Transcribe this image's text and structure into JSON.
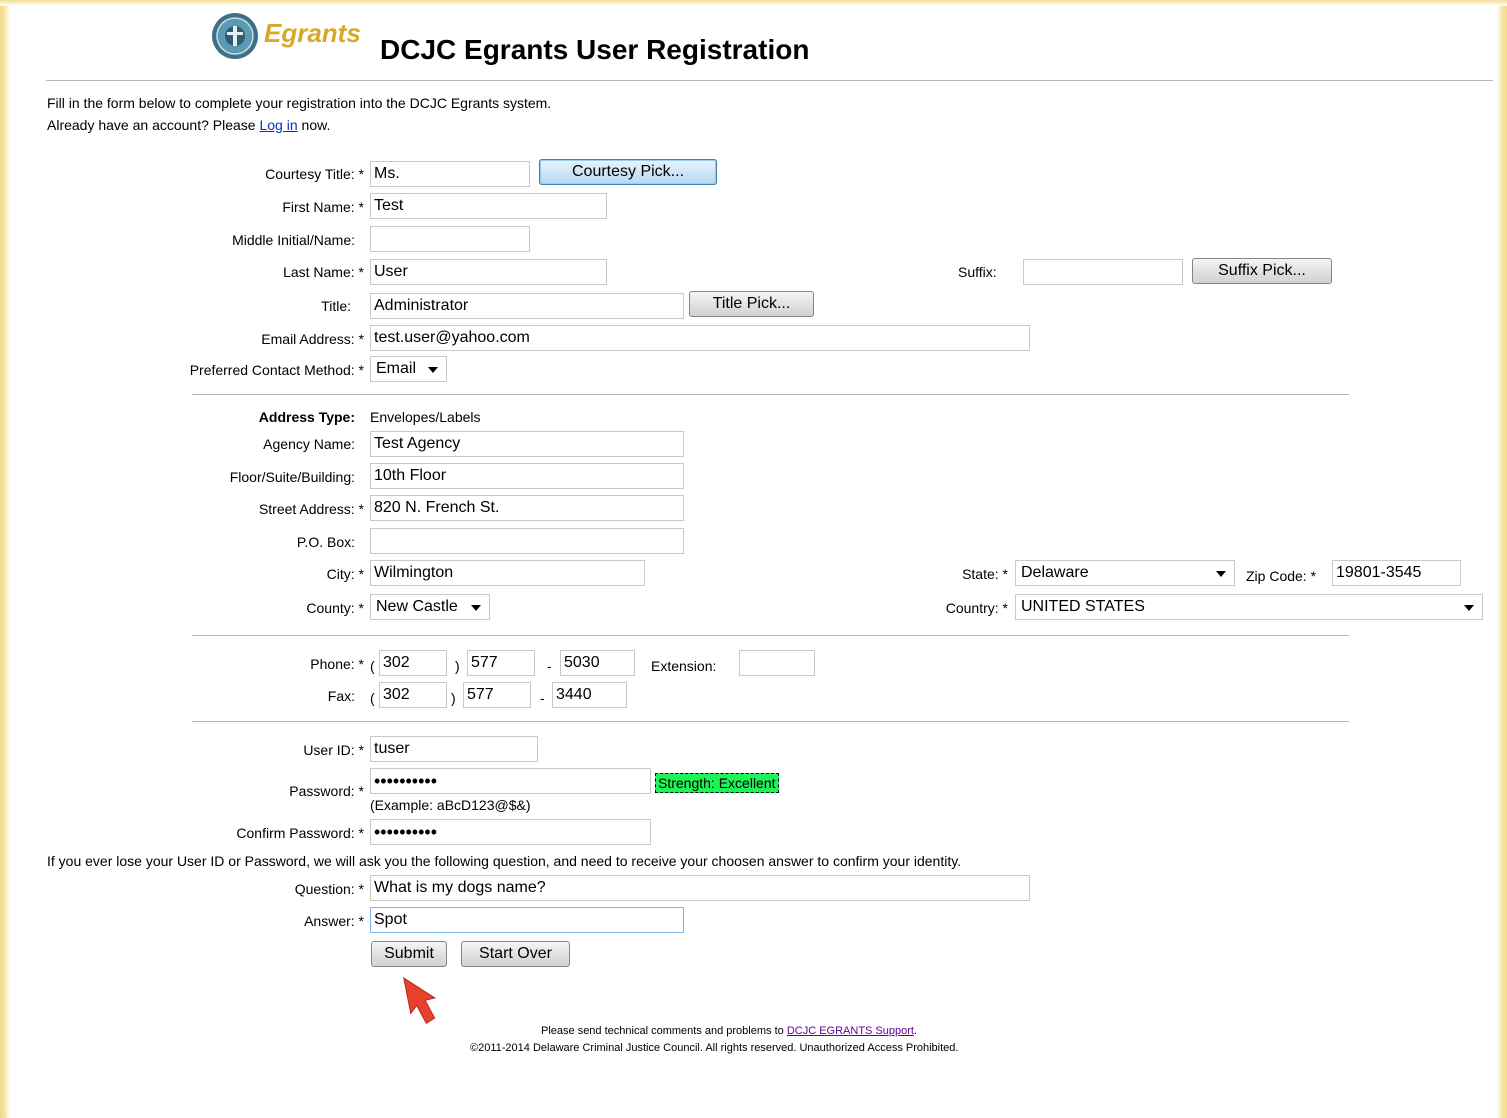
{
  "header": {
    "logo_text": "Egrants",
    "page_title": "DCJC Egrants User Registration"
  },
  "intro": {
    "line1": "Fill in the form below to complete your registration into the DCJC Egrants system.",
    "line2_before": "Already have an account? Please ",
    "login_link": "Log in",
    "line2_after": " now."
  },
  "fields": {
    "courtesy_title": {
      "label": "Courtesy Title: *",
      "value": "Ms.",
      "button": "Courtesy Pick..."
    },
    "first_name": {
      "label": "First Name: *",
      "value": "Test"
    },
    "middle_name": {
      "label": "Middle Initial/Name:",
      "value": ""
    },
    "last_name": {
      "label": "Last Name: *",
      "value": "User"
    },
    "suffix": {
      "label": "Suffix:",
      "value": "",
      "button": "Suffix Pick..."
    },
    "title": {
      "label": "Title:",
      "value": "Administrator",
      "button": "Title Pick..."
    },
    "email": {
      "label": "Email Address: *",
      "value": "test.user@yahoo.com"
    },
    "contact_method": {
      "label": "Preferred Contact Method: *",
      "value": "Email"
    }
  },
  "address": {
    "type_label": "Address Type:",
    "type_value": "Envelopes/Labels",
    "agency": {
      "label": "Agency Name:",
      "value": "Test Agency"
    },
    "floor": {
      "label": "Floor/Suite/Building:",
      "value": "10th Floor"
    },
    "street": {
      "label": "Street Address: *",
      "value": "820 N. French St."
    },
    "po_box": {
      "label": "P.O. Box:",
      "value": ""
    },
    "city": {
      "label": "City: *",
      "value": "Wilmington"
    },
    "state": {
      "label": "State: *",
      "value": "Delaware"
    },
    "zip": {
      "label": "Zip Code: *",
      "value": "19801-3545"
    },
    "county": {
      "label": "County: *",
      "value": "New Castle"
    },
    "country": {
      "label": "Country: *",
      "value": "UNITED STATES"
    }
  },
  "phone": {
    "label": "Phone: *",
    "area": "302",
    "prefix": "577",
    "line": "5030",
    "extension_label": "Extension:",
    "extension": "",
    "paren_open": "(",
    "paren_close": ")",
    "dash": "-"
  },
  "fax": {
    "label": "Fax:",
    "area": "302",
    "prefix": "577",
    "line": "3440"
  },
  "account": {
    "user_id": {
      "label": "User ID: *",
      "value": "tuser"
    },
    "password": {
      "label": "Password: *",
      "value": "••••••••••",
      "example": "(Example: aBcD123@$&)",
      "strength": "Strength: Excellent"
    },
    "confirm": {
      "label": "Confirm Password: *",
      "value": "••••••••••"
    }
  },
  "security": {
    "note": "If you ever lose your User ID or Password, we will ask you the following question, and need to receive your choosen answer to confirm your identity.",
    "question": {
      "label": "Question: *",
      "value": "What is my dogs name?"
    },
    "answer": {
      "label": "Answer: *",
      "value": "Spot"
    }
  },
  "buttons": {
    "submit": "Submit",
    "start_over": "Start Over"
  },
  "footer": {
    "line1_before": "Please send technical comments and problems to ",
    "support_link": "DCJC EGRANTS Support",
    "line1_after": ".",
    "line2": "©2011-2014 Delaware Criminal Justice Council. All rights reserved. Unauthorized Access Prohibited."
  },
  "colors": {
    "strength_bg": "#20f25a",
    "link": "#0033cc",
    "arrow": "#e8412c"
  }
}
